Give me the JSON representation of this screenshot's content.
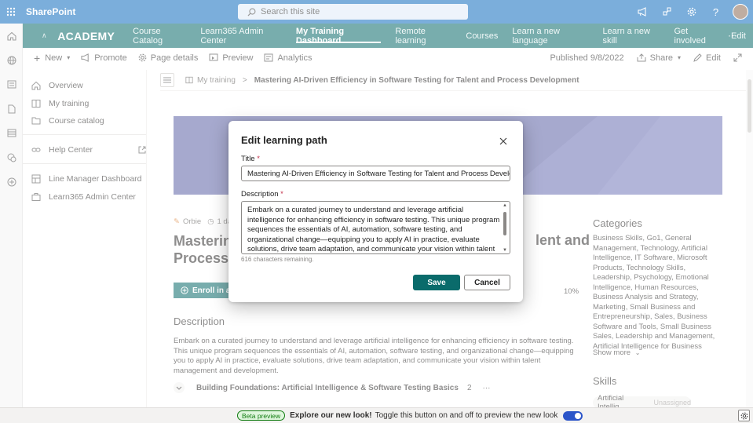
{
  "suite": {
    "app_name": "SharePoint",
    "search_placeholder": "Search this site"
  },
  "hub": {
    "name": "ACADEMY",
    "links": [
      "Course Catalog",
      "Learn365 Admin Center",
      "My Training Dashboard",
      "Remote learning",
      "Courses",
      "Learn a new language",
      "Learn a new skill",
      "Get involved",
      "Edit"
    ],
    "active_link": "My Training Dashboard",
    "more": "···"
  },
  "command_bar": {
    "new": "New",
    "promote": "Promote",
    "page_details": "Page details",
    "preview": "Preview",
    "analytics": "Analytics",
    "published": "Published 9/8/2022",
    "share": "Share",
    "edit": "Edit"
  },
  "left_nav": {
    "items": [
      "Overview",
      "My training",
      "Course catalog"
    ],
    "help": "Help Center",
    "extra": [
      "Line Manager Dashboard",
      "Learn365 Admin Center"
    ]
  },
  "breadcrumb": {
    "parent": "My training",
    "separator": ">",
    "current": "Mastering AI-Driven Efficiency in Software Testing for Talent and Process Development"
  },
  "course": {
    "author": "Orbie",
    "duration": "1 da",
    "title_line1": "Mastering",
    "title_line2": "Process D",
    "title_right": "lent and",
    "enroll": "Enroll in all",
    "progress": "10%",
    "description_heading": "Description",
    "description": "Embark on a curated journey to understand and leverage artificial intelligence for enhancing efficiency in software testing. This unique program sequences the essentials of AI, automation, software testing, and organizational change—equipping you to apply AI in practice, evaluate solutions, drive team adaptation, and communicate your vision within talent management and development.",
    "module_title": "Building Foundations: Artificial Intelligence & Software Testing Basics",
    "module_count": "2",
    "module_more": "···"
  },
  "sidebar": {
    "categories_heading": "Categories",
    "categories": "Business Skills, Go1, General Management, Technology, Artificial Intelligence, IT Software, Microsoft Products, Technology Skills, Leadership, Psychology, Emotional Intelligence, Human Resources, Business Analysis and Strategy, Marketing, Small Business and Entrepreneurship, Sales, Business Software and Tools, Small Business Sales, Leadership and Management, Artificial Intelligence for Business",
    "show_more": "Show more",
    "skills_heading": "Skills",
    "skill_name": "Artificial Intellig...",
    "skill_status": "Unassigned"
  },
  "footer": {
    "badge": "Beta preview",
    "bold": "Explore our new look!",
    "text": "Toggle this button on and off to preview the new look",
    "toggle_on": true
  },
  "dialog": {
    "title": "Edit learning path",
    "title_label": "Title",
    "title_value": "Mastering AI-Driven Efficiency in Software Testing for Talent and Process Development",
    "description_label": "Description",
    "description_value": "Embark on a curated journey to understand and leverage artificial intelligence for enhancing efficiency in software testing. This unique program sequences the essentials of AI, automation, software testing, and organizational change—equipping you to apply AI in practice, evaluate solutions, drive team adaptation, and communicate your vision within talent management and development.",
    "required_mark": "*",
    "remaining": "616 characters remaining.",
    "save": "Save",
    "cancel": "Cancel"
  },
  "colors": {
    "suite": "#0f6cbd",
    "hub": "#0a6b6b",
    "banner": "#5e63a6",
    "primary": "#0a6b6b"
  },
  "icons": [
    "waffle-icon",
    "search-icon",
    "megaphone-icon",
    "share-network-icon",
    "gear-icon",
    "help-icon",
    "home-icon",
    "globe-icon",
    "news-icon",
    "file-icon",
    "list-icon",
    "chat-icon",
    "add-icon",
    "close-icon"
  ]
}
